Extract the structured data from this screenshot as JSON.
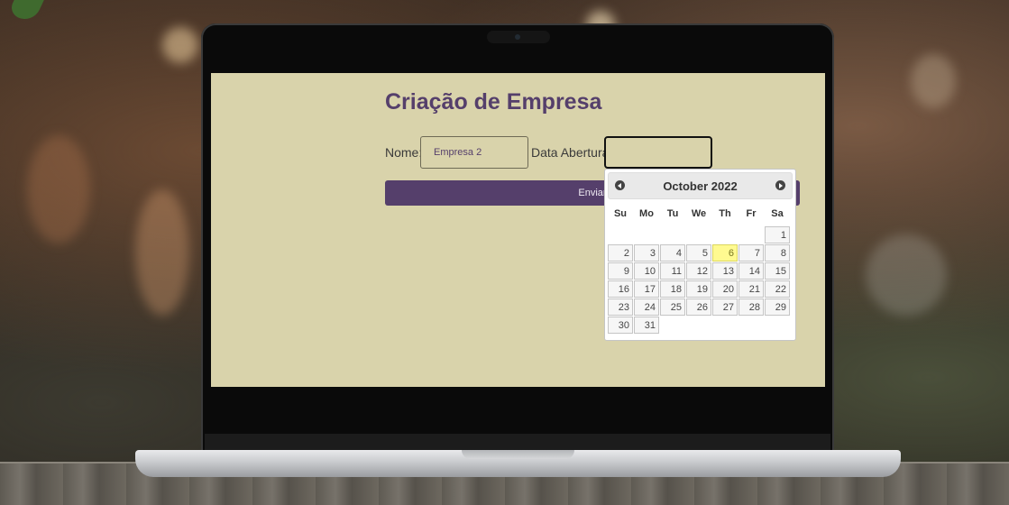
{
  "form": {
    "title": "Criação de Empresa",
    "nome_label": "Nome:",
    "nome_value": "Empresa 2",
    "data_label": "Data Abertura:",
    "data_value": "",
    "submit_label": "Enviar"
  },
  "datepicker": {
    "month_title": "October 2022",
    "weekdays": [
      "Su",
      "Mo",
      "Tu",
      "We",
      "Th",
      "Fr",
      "Sa"
    ],
    "leading_blanks": 6,
    "days": [
      "1",
      "2",
      "3",
      "4",
      "5",
      "6",
      "7",
      "8",
      "9",
      "10",
      "11",
      "12",
      "13",
      "14",
      "15",
      "16",
      "17",
      "18",
      "19",
      "20",
      "21",
      "22",
      "23",
      "24",
      "25",
      "26",
      "27",
      "28",
      "29",
      "30",
      "31"
    ],
    "today": "6"
  },
  "colors": {
    "page_bg": "#d9d3ab",
    "accent": "#553f6b",
    "today_highlight": "#fffa90"
  },
  "icons": {
    "prev": "circle-triangle-west-icon",
    "next": "circle-triangle-east-icon"
  }
}
